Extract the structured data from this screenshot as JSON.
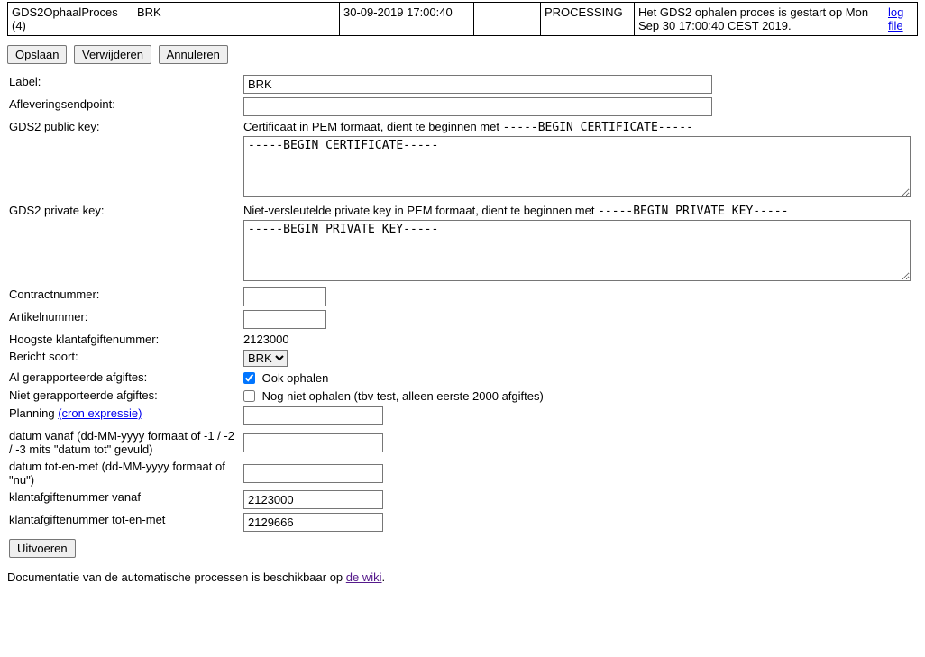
{
  "topRow": {
    "process": "GDS2OphaalProces (4)",
    "name": "BRK",
    "datetime": "30-09-2019 17:00:40",
    "status": "PROCESSING",
    "message": "Het GDS2 ophalen proces is gestart op Mon Sep 30 17:00:40 CEST 2019.",
    "logfile": "log file"
  },
  "buttons": {
    "save": "Opslaan",
    "delete": "Verwijderen",
    "cancel": "Annuleren",
    "execute": "Uitvoeren"
  },
  "labels": {
    "label": "Label:",
    "endpoint": "Afleveringsendpoint:",
    "pubkey": "GDS2 public key:",
    "pubkey_hint_pre": "Certificaat in PEM formaat, dient te beginnen met ",
    "pubkey_hint_mono": "-----BEGIN CERTIFICATE-----",
    "privkey": "GDS2 private key:",
    "privkey_hint_pre": "Niet-versleutelde private key in PEM formaat, dient te beginnen met ",
    "privkey_hint_mono": "-----BEGIN PRIVATE KEY-----",
    "contractnr": "Contractnummer:",
    "artikelnr": "Artikelnummer:",
    "hoogste": "Hoogste klantafgiftenummer:",
    "berichtsoort": "Bericht soort:",
    "al_gerapp": "Al gerapporteerde afgiftes:",
    "al_gerapp_chk": "Ook ophalen",
    "niet_gerapp": "Niet gerapporteerde afgiftes:",
    "niet_gerapp_chk": "Nog niet ophalen (tbv test, alleen eerste 2000 afgiftes)",
    "planning": "Planning ",
    "planning_link": "(cron expressie)",
    "datum_vanaf": "datum vanaf (dd-MM-yyyy formaat of -1 / -2 / -3 mits \"datum tot\" gevuld)",
    "datum_tot": "datum tot-en-met (dd-MM-yyyy formaat of \"nu\")",
    "klant_vanaf": "klantafgiftenummer vanaf",
    "klant_tot": "klantafgiftenummer tot-en-met"
  },
  "values": {
    "label": "BRK",
    "endpoint": "",
    "pubkey": "-----BEGIN CERTIFICATE-----",
    "privkey": "-----BEGIN PRIVATE KEY-----",
    "contractnr": "",
    "artikelnr": "",
    "hoogste": "2123000",
    "berichtsoort_selected": "BRK",
    "al_gerapp_checked": true,
    "niet_gerapp_checked": false,
    "planning": "",
    "datum_vanaf": "",
    "datum_tot": "",
    "klant_vanaf": "2123000",
    "klant_tot": "2129666"
  },
  "berichtsoort_options": [
    "BRK"
  ],
  "doc": {
    "pre": "Documentatie van de automatische processen is beschikbaar op ",
    "link": "de wiki",
    "post": "."
  }
}
